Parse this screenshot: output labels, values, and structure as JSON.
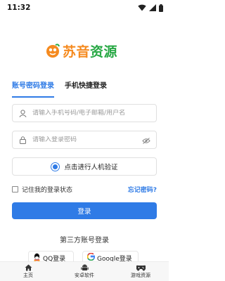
{
  "status": {
    "time": "11:32"
  },
  "logo": {
    "text_part1": "苏音",
    "text_part2": "资源"
  },
  "tabs": [
    {
      "label": "账号密码登录",
      "active": true
    },
    {
      "label": "手机快捷登录",
      "active": false
    }
  ],
  "form": {
    "username_placeholder": "请输入手机号码/电子邮箱/用户名",
    "password_placeholder": "请输入登录密码",
    "captcha_label": "点击进行人机验证",
    "remember_label": "记住我的登录状态",
    "forgot_label": "忘记密码?",
    "login_label": "登录"
  },
  "third_party": {
    "title": "第三方账号登录",
    "qq_label": "QQ登录",
    "google_label": "Google登录"
  },
  "nav": [
    {
      "label": "主页",
      "icon": "home-icon"
    },
    {
      "label": "安卓软件",
      "icon": "android-icon"
    },
    {
      "label": "游戏资源",
      "icon": "gamepad-icon"
    }
  ],
  "colors": {
    "accent": "#2f7be6",
    "logo_orange": "#f58a1f",
    "logo_green": "#27a844"
  }
}
